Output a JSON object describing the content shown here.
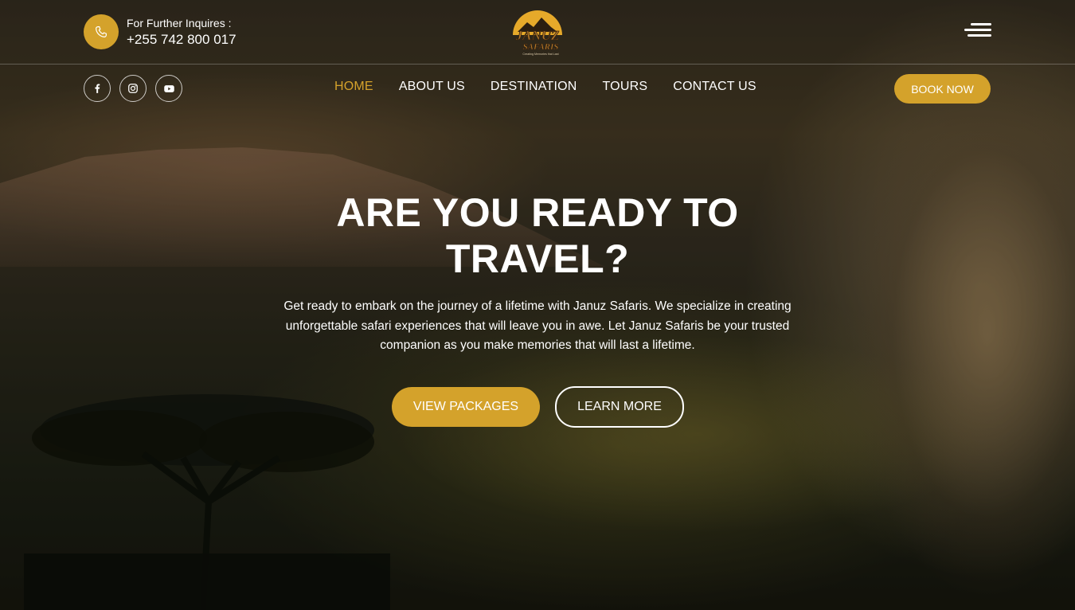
{
  "header": {
    "phone_label": "For Further Inquires :",
    "phone_number": "+255 742 800 017",
    "logo": {
      "title": "JANUZ",
      "subtitle": "SAFARIS",
      "tagline": "Creating Memories that Last"
    }
  },
  "socials": [
    {
      "icon": "facebook-icon"
    },
    {
      "icon": "instagram-icon"
    },
    {
      "icon": "youtube-icon"
    }
  ],
  "nav": {
    "items": [
      {
        "label": "HOME",
        "active": true
      },
      {
        "label": "ABOUT US",
        "active": false
      },
      {
        "label": "DESTINATION",
        "active": false
      },
      {
        "label": "TOURS",
        "active": false
      },
      {
        "label": "CONTACT US",
        "active": false
      }
    ],
    "book_label": "BOOK NOW"
  },
  "hero": {
    "headline_line1": "ARE YOU READY TO",
    "headline_line2": "TRAVEL?",
    "description_line1": "Get ready to embark on the journey of a lifetime with Januz Safaris. We specialize in creating",
    "description_line2": "unforgettable safari experiences that will leave you in awe. Let Januz Safaris be your trusted",
    "description_line3": "companion as you make memories that will last a lifetime.",
    "primary_button": "VIEW PACKAGES",
    "secondary_button": "LEARN MORE"
  },
  "colors": {
    "accent": "#d4a22b",
    "text": "#ffffff"
  }
}
